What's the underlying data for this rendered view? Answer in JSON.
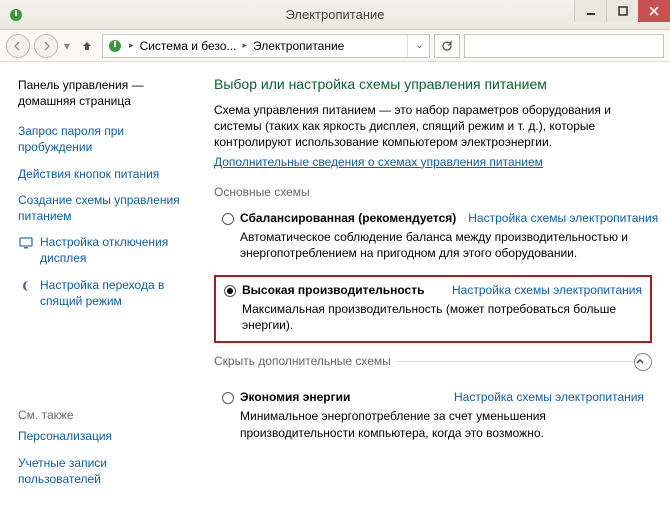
{
  "window": {
    "title": "Электропитание",
    "minimize_tip": "Свернуть",
    "maximize_tip": "Развернуть",
    "close_tip": "Закрыть"
  },
  "nav": {
    "back_tip": "Назад",
    "forward_tip": "Вперёд",
    "up_tip": "Вверх",
    "crumb1": "Система и безо...",
    "crumb2": "Электропитание",
    "refresh_tip": "Обновить",
    "search_placeholder": ""
  },
  "sidebar": {
    "home": "Панель управления — домашняя страница",
    "items": [
      "Запрос пароля при пробуждении",
      "Действия кнопок питания",
      "Создание схемы управления питанием",
      "Настройка отключения дисплея",
      "Настройка перехода в спящий режим"
    ],
    "see_also_label": "См. также",
    "see_also": [
      "Персонализация",
      "Учетные записи пользователей"
    ]
  },
  "main": {
    "heading": "Выбор или настройка схемы управления питанием",
    "intro": "Схема управления питанием — это набор параметров оборудования и системы (таких как яркость дисплея, спящий режим и т. д.), которые контролируют использование компьютером электроэнергии.",
    "more_link": "Дополнительные сведения о схемах управления питанием",
    "section_basic": "Основные схемы",
    "section_hidden": "Скрыть дополнительные схемы",
    "config_label": "Настройка схемы электропитания",
    "plans": [
      {
        "name": "Сбалансированная (рекомендуется)",
        "desc": "Автоматическое соблюдение баланса между производительностью и энергопотреблением на пригодном для этого оборудовании.",
        "selected": false
      },
      {
        "name": "Высокая производительность",
        "desc": "Максимальная производительность (может потребоваться больше энергии).",
        "selected": true
      },
      {
        "name": "Экономия энергии",
        "desc": "Минимальное энергопотребление за счет уменьшения производительности компьютера, когда это возможно.",
        "selected": false
      }
    ]
  },
  "colors": {
    "link": "#0e5da8",
    "heading": "#0b5f2f",
    "highlight": "#a32020"
  }
}
